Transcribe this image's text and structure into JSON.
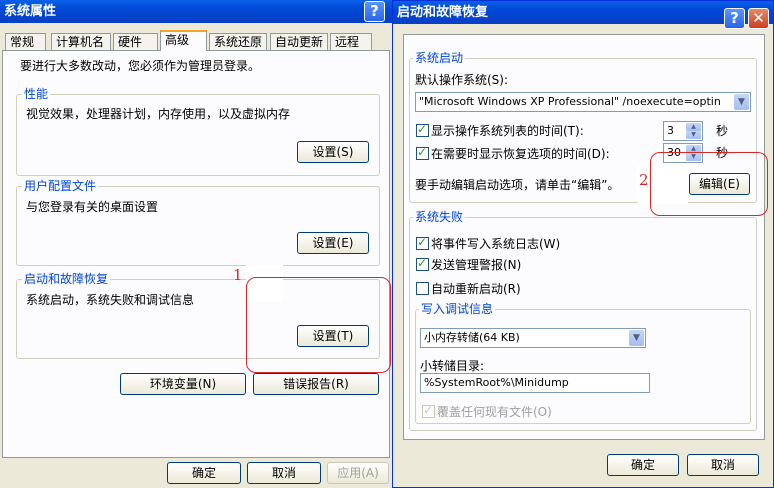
{
  "left_dialog": {
    "title": "系统属性",
    "tabs": [
      "常规",
      "计算机名",
      "硬件",
      "高级",
      "系统还原",
      "自动更新",
      "远程"
    ],
    "active_tab": "高级",
    "admin_notice": "要进行大多数改动，您必须作为管理员登录。",
    "performance": {
      "title": "性能",
      "desc": "视觉效果，处理器计划，内存使用，以及虚拟内存",
      "button": "设置(S)"
    },
    "user_profiles": {
      "title": "用户配置文件",
      "desc": "与您登录有关的桌面设置",
      "button": "设置(E)"
    },
    "startup_recovery": {
      "title": "启动和故障恢复",
      "desc": "系统启动，系统失败和调试信息",
      "button": "设置(T)"
    },
    "env_button": "环境变量(N)",
    "error_button": "错误报告(R)",
    "ok": "确定",
    "cancel": "取消",
    "apply": "应用(A)",
    "annotation_number": "1"
  },
  "right_dialog": {
    "title": "启动和故障恢复",
    "system_startup": {
      "title": "系统启动",
      "default_os_label": "默认操作系统(S):",
      "default_os_value": "\"Microsoft Windows XP Professional\" /noexecute=optin",
      "show_os_list_label": "显示操作系统列表的时间(T):",
      "show_os_list_checked": true,
      "show_os_list_value": "3",
      "show_recovery_label": "在需要时显示恢复选项的时间(D):",
      "show_recovery_checked": true,
      "show_recovery_value": "30",
      "seconds_unit": "秒",
      "edit_hint": "要手动编辑启动选项，请单击“编辑”。",
      "edit_button": "编辑(E)"
    },
    "system_failure": {
      "title": "系统失败",
      "write_event_label": "将事件写入系统日志(W)",
      "write_event_checked": true,
      "send_alert_label": "发送管理警报(N)",
      "send_alert_checked": true,
      "auto_restart_label": "自动重新启动(R)",
      "auto_restart_checked": false,
      "debug_info": {
        "title": "写入调试信息",
        "dump_type": "小内存转储(64 KB)",
        "dump_dir_label": "小转储目录:",
        "dump_dir_value": "%SystemRoot%\\Minidump",
        "overwrite_label": "覆盖任何现有文件(O)",
        "overwrite_checked": true
      }
    },
    "ok": "确定",
    "cancel": "取消",
    "annotation_number": "2"
  },
  "colors": {
    "title_bar": "#0047d6",
    "group_title": "#0046d5",
    "annotation_red": "#d8282a",
    "dialog_bg": "#ece9d8"
  },
  "icons": {
    "help": "help-icon",
    "close": "close-icon",
    "dropdown": "chevron-down-icon",
    "spin": "spin-arrows-icon"
  }
}
